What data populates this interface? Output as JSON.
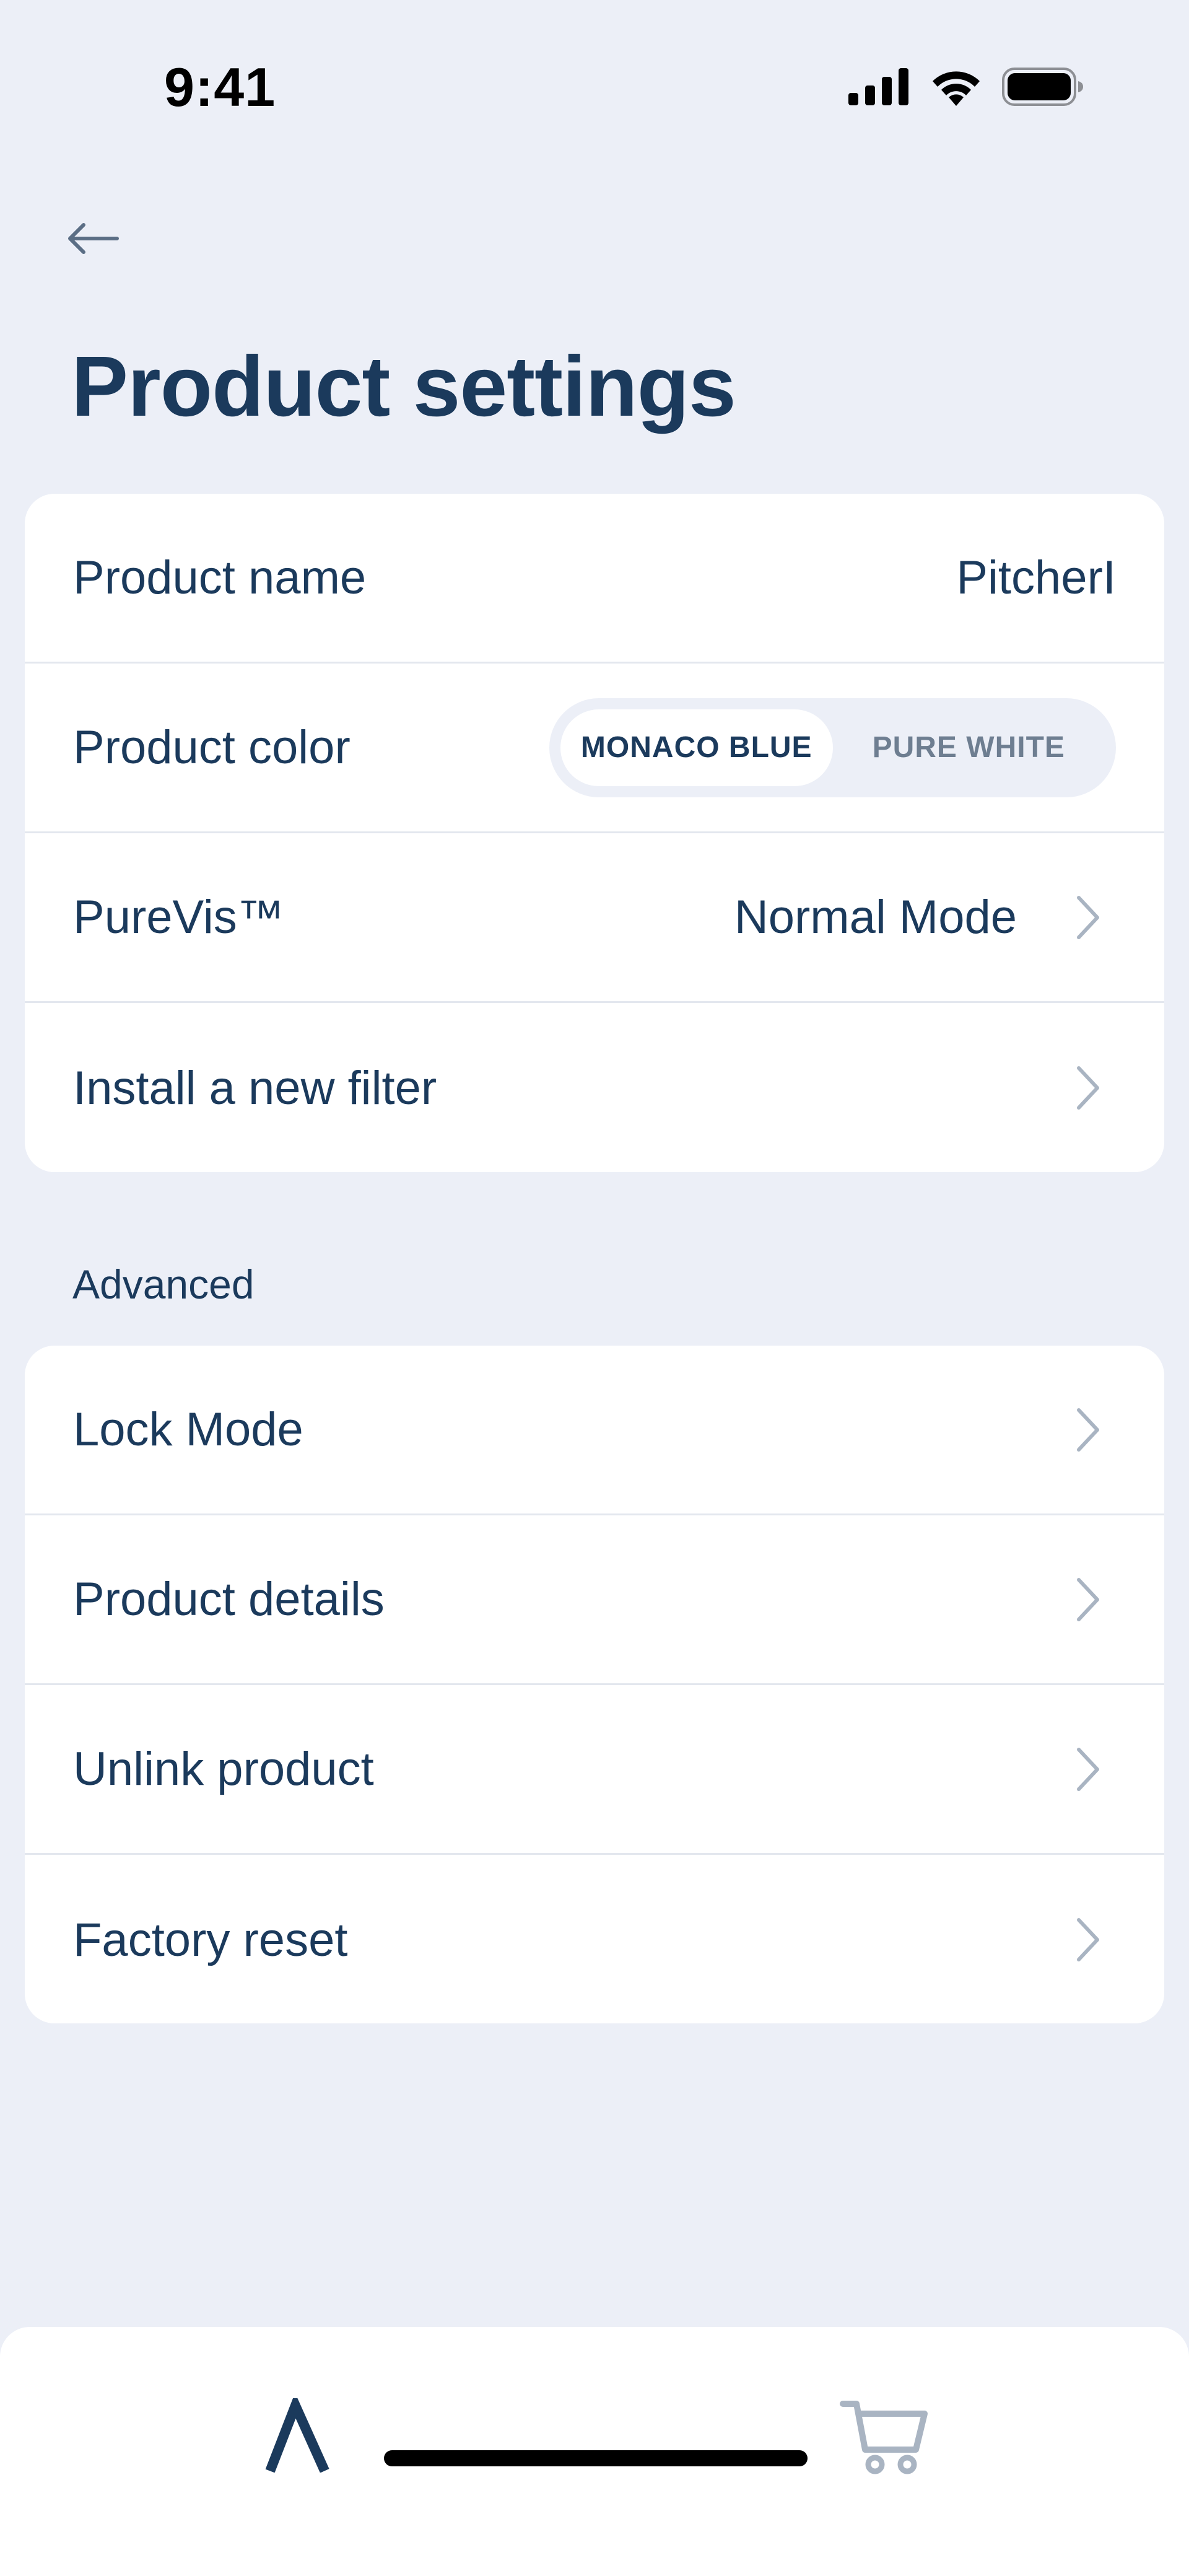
{
  "status_bar": {
    "time": "9:41",
    "icons": [
      "signal-icon",
      "wifi-icon",
      "battery-icon"
    ]
  },
  "header": {
    "back_icon": "arrow-left-icon",
    "title": "Product settings"
  },
  "settings_card": {
    "product_name": {
      "label": "Product name",
      "value": "PitcherI"
    },
    "product_color": {
      "label": "Product color",
      "options": [
        "MONACO BLUE",
        "PURE WHITE"
      ],
      "selected": "MONACO BLUE"
    },
    "purevis": {
      "label": "PureVis™",
      "value": "Normal Mode"
    },
    "install_filter": {
      "label": "Install a new filter"
    }
  },
  "advanced": {
    "header": "Advanced",
    "items": [
      {
        "label": "Lock Mode"
      },
      {
        "label": "Product details"
      },
      {
        "label": "Unlink product"
      },
      {
        "label": "Factory reset"
      }
    ]
  },
  "tab_bar": {
    "tabs": [
      {
        "icon": "lambda-icon",
        "active": true
      },
      {
        "icon": "cart-icon",
        "active": false
      }
    ]
  },
  "colors": {
    "background": "#ECEFF7",
    "text_primary": "#1B3A5C",
    "text_secondary": "#6E7E91",
    "chevron": "#A9B4C2",
    "card": "#FFFFFF"
  }
}
